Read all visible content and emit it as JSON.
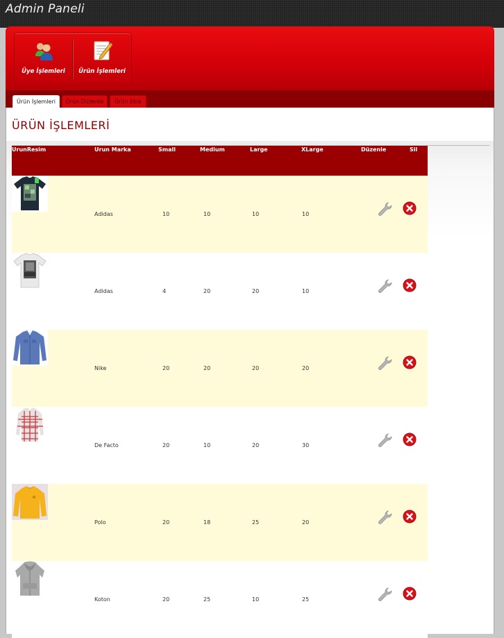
{
  "app": {
    "title": "Admin Paneli"
  },
  "modules": [
    {
      "label": "Üye İşlemleri",
      "icon": "users-icon"
    },
    {
      "label": "Ürün İşlemleri",
      "icon": "edit-document-icon"
    }
  ],
  "tabs": [
    {
      "label": "Ürün İşlemleri",
      "active": true
    },
    {
      "label": "Ürün Düzenle",
      "active": false
    },
    {
      "label": "Ürün Ekle",
      "active": false
    }
  ],
  "page": {
    "title": "ÜRÜN İŞLEMLERİ"
  },
  "table": {
    "headers": [
      "UrunResim",
      "Urun Marka",
      "Small",
      "Medium",
      "Large",
      "XLarge",
      "Düzenle",
      "Sil"
    ],
    "rows": [
      {
        "image": "navy-tshirt",
        "brand": "Adidas",
        "small": "10",
        "medium": "10",
        "large": "10",
        "xlarge": "10"
      },
      {
        "image": "white-print-tshirt",
        "brand": "Adidas",
        "small": "4",
        "medium": "20",
        "large": "20",
        "xlarge": "10"
      },
      {
        "image": "blue-shirt",
        "brand": "Nike",
        "small": "20",
        "medium": "20",
        "large": "20",
        "xlarge": "20"
      },
      {
        "image": "plaid-shirt",
        "brand": "De Facto",
        "small": "20",
        "medium": "10",
        "large": "20",
        "xlarge": "30"
      },
      {
        "image": "yellow-sweatshirt",
        "brand": "Polo",
        "small": "20",
        "medium": "18",
        "large": "25",
        "xlarge": "20"
      },
      {
        "image": "grey-hoodie",
        "brand": "Koton",
        "small": "20",
        "medium": "25",
        "large": "10",
        "xlarge": "25"
      }
    ]
  },
  "colors": {
    "brand_red": "#d40009",
    "header_row": "#9a0000",
    "row_highlight": "#fffad7",
    "title_red": "#8a0000",
    "delete_red": "#d8121a"
  }
}
